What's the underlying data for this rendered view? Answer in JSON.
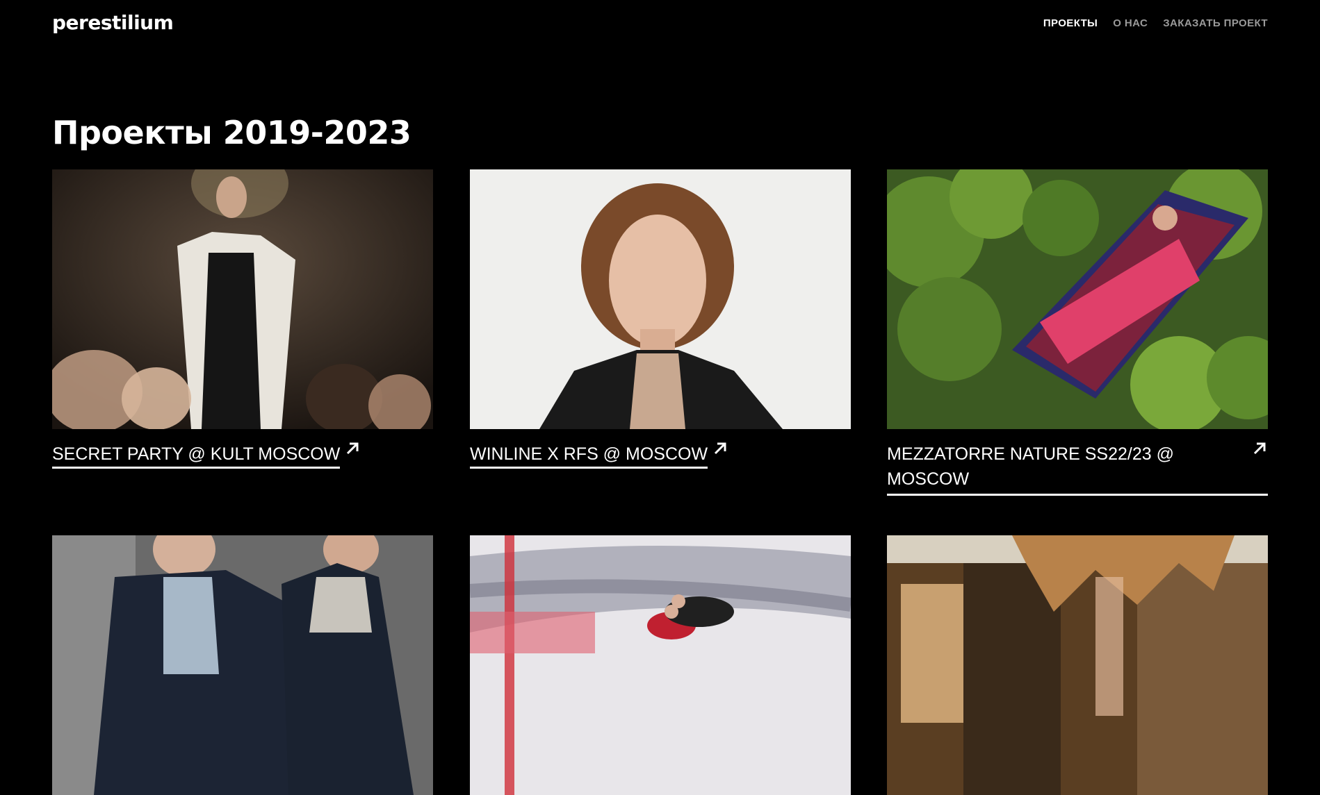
{
  "header": {
    "logo": "perestilium",
    "nav": [
      {
        "label": "ПРОЕКТЫ",
        "active": true
      },
      {
        "label": "О НАС",
        "active": false
      },
      {
        "label": "ЗАКАЗАТЬ ПРОЕКТ",
        "active": false
      }
    ]
  },
  "main": {
    "title": "Проекты 2019-2023",
    "projects": [
      {
        "title": "SECRET PARTY @ KULT MOSCOW",
        "icon": "arrow-up-right-icon"
      },
      {
        "title": "WINLINE X RFS @ MOSCOW",
        "icon": "arrow-up-right-icon"
      },
      {
        "title": "MEZZATORRE NATURE SS22/23 @ MOSCOW",
        "icon": "arrow-up-right-icon"
      },
      {
        "title": "",
        "icon": ""
      },
      {
        "title": "",
        "icon": ""
      },
      {
        "title": "",
        "icon": ""
      }
    ]
  },
  "colors": {
    "background": "#000000",
    "text": "#ffffff",
    "nav_inactive": "#9a9a9a"
  }
}
